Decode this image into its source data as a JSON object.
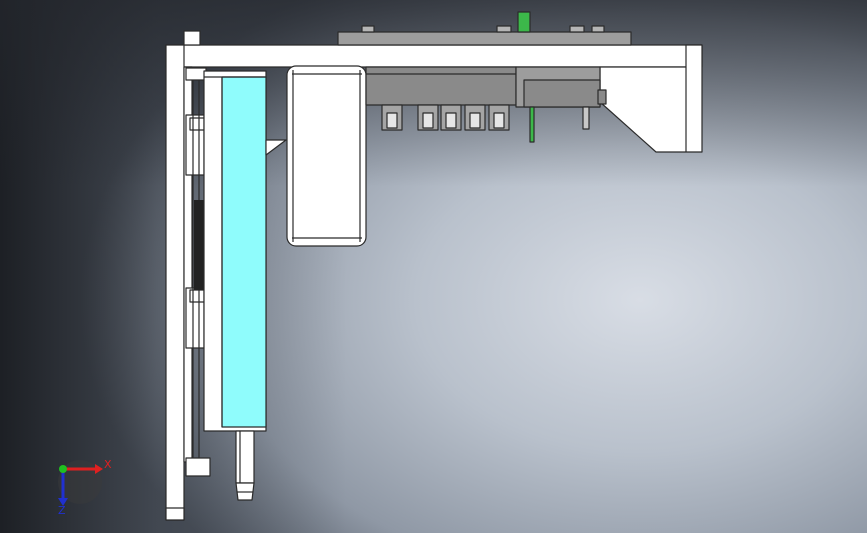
{
  "viewport": {
    "background_colors": [
      "#4f5661",
      "#8f98a5",
      "#d8dde5"
    ]
  },
  "model": {
    "part_colors": {
      "frame_fill": "#ffffff",
      "edge": "#2b2b2b",
      "slide_cover": "#8ffcfc",
      "dark_grey_block": "#8a8a8a",
      "mid_grey_block": "#9d9d9d",
      "green_part": "#3cb84a"
    }
  },
  "triad": {
    "x_label": "X",
    "z_label": "Z",
    "x_color": "#e02020",
    "y_color": "#20c020",
    "z_color": "#2030d0"
  }
}
